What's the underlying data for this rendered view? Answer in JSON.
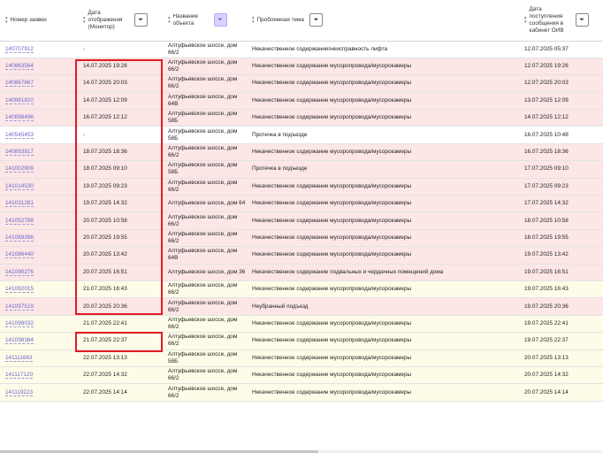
{
  "columns": {
    "number": "Номер заявки",
    "display_date": "Дата отображения (Монитор)",
    "object": "Название объекта",
    "topic": "Проблемная тема",
    "received": "Дата поступления сообщения в кабинет ОИВ"
  },
  "icons": {
    "sort": "sort-icon",
    "filter": "filter-icon"
  },
  "colors": {
    "pink_row": "#fde6e6",
    "cream_row": "#fefce8",
    "highlight": "#e01b24",
    "link": "#6a66c9"
  },
  "rows": [
    {
      "id": "140707912",
      "display": "-",
      "object": "Алтуфьевское шоссе, дом 66/2",
      "topic": "Некачественное содержание/неисправность лифта",
      "received": "12.07.2025 05:37",
      "tone": "white"
    },
    {
      "id": "140863564",
      "display": "14.07.2025 19:26",
      "object": "Алтуфьевское шоссе, дом 66/2",
      "topic": "Некачественное содержание мусоропровода/мусорокамеры",
      "received": "12.07.2025 19:26",
      "tone": "pink"
    },
    {
      "id": "140867867",
      "display": "14.07.2025 20:03",
      "object": "Алтуфьевское шоссе, дом 66/2",
      "topic": "Некачественное содержание мусоропровода/мусорокамеры",
      "received": "12.07.2025 20:03",
      "tone": "pink"
    },
    {
      "id": "140881810",
      "display": "14.07.2025 12:09",
      "object": "Алтуфьевское шоссе, дом 64В",
      "topic": "Некачественное содержание мусоропровода/мусорокамеры",
      "received": "13.07.2025 12:09",
      "tone": "pink"
    },
    {
      "id": "140898496",
      "display": "16.07.2025 12:12",
      "object": "Алтуфьевское шоссе, дом 58Б",
      "topic": "Некачественное содержание мусоропровода/мусорокамеры",
      "received": "14.07.2025 12:12",
      "tone": "pink"
    },
    {
      "id": "140545453",
      "display": "-",
      "object": "Алтуфьевское шоссе, дом 58Б",
      "topic": "Протечка в подъезде",
      "received": "16.07.2025 10:48",
      "tone": "white"
    },
    {
      "id": "140893817",
      "display": "18.07.2025 18:36",
      "object": "Алтуфьевское шоссе, дом 66/2",
      "topic": "Некачественное содержание мусоропровода/мусорокамеры",
      "received": "16.07.2025 18:36",
      "tone": "pink"
    },
    {
      "id": "141002909",
      "display": "18.07.2025 09:10",
      "object": "Алтуфьевское шоссе, дом 58Б",
      "topic": "Протечка в подъезде",
      "received": "17.07.2025 09:10",
      "tone": "pink"
    },
    {
      "id": "141014530",
      "display": "19.07.2025 09:23",
      "object": "Алтуфьевское шоссе, дом 66/2",
      "topic": "Некачественное содержание мусоропровода/мусорокамеры",
      "received": "17.07.2025 09:23",
      "tone": "pink"
    },
    {
      "id": "141031281",
      "display": "19.07.2025 14:32",
      "object": "Алтуфьевское шоссе, дом 64",
      "topic": "Некачественное содержание мусоропровода/мусорокамеры",
      "received": "17.07.2025 14:32",
      "tone": "pink"
    },
    {
      "id": "141052788",
      "display": "20.07.2025 10:58",
      "object": "Алтуфьевское шоссе, дом 66/2",
      "topic": "Некачественное содержание мусоропровода/мусорокамеры",
      "received": "18.07.2025 10:58",
      "tone": "pink"
    },
    {
      "id": "141069396",
      "display": "20.07.2025 19:55",
      "object": "Алтуфьевское шоссе, дом 66/2",
      "topic": "Некачественное содержание мусоропровода/мусорокамеры",
      "received": "18.07.2025 19:55",
      "tone": "pink"
    },
    {
      "id": "141086440",
      "display": "20.07.2025 13:42",
      "object": "Алтуфьевское шоссе, дом 64В",
      "topic": "Некачественное содержание мусоропровода/мусорокамеры",
      "received": "19.07.2025 13:42",
      "tone": "pink"
    },
    {
      "id": "141090276",
      "display": "20.07.2025 16:51",
      "object": "Алтуфьевское шоссе, дом 36",
      "topic": "Некачественное содержание подвальных и чердачных помещений дома",
      "received": "19.07.2025 16:51",
      "tone": "pink"
    },
    {
      "id": "141092015",
      "display": "21.07.2025 16:43",
      "object": "Алтуфьевское шоссе, дом 66/2",
      "topic": "Некачественное содержание мусоропровода/мусорокамеры",
      "received": "19.07.2025 16:43",
      "tone": "cream"
    },
    {
      "id": "141097519",
      "display": "20.07.2025 20:36",
      "object": "Алтуфьевское шоссе, дом 66/2",
      "topic": "Неубранный подъезд",
      "received": "19.07.2025 20:36",
      "tone": "pink"
    },
    {
      "id": "141098032",
      "display": "21.07.2025 22:41",
      "object": "Алтуфьевское шоссе, дом 66/2",
      "topic": "Некачественное содержание мусоропровода/мусорокамеры",
      "received": "19.07.2025 22:41",
      "tone": "cream"
    },
    {
      "id": "141098384",
      "display": "21.07.2025 22:37",
      "object": "Алтуфьевское шоссе, дом 66/2",
      "topic": "Некачественное содержание мусоропровода/мусорокамеры",
      "received": "19.07.2025 22:37",
      "tone": "cream"
    },
    {
      "id": "141111663",
      "display": "22.07.2025 13:13",
      "object": "Алтуфьевское шоссе, дом 58Б",
      "topic": "Некачественное содержание мусоропровода/мусорокамеры",
      "received": "20.07.2025 13:13",
      "tone": "cream"
    },
    {
      "id": "141117120",
      "display": "22.07.2025 14:32",
      "object": "Алтуфьевское шоссе, дом 66/2",
      "topic": "Некачественное содержание мусоропровода/мусорокамеры",
      "received": "20.07.2025 14:32",
      "tone": "cream"
    },
    {
      "id": "141119223",
      "display": "22.07.2025 14:14",
      "object": "Алтуфьевское шоссе, дом 66/2",
      "topic": "Некачественное содержание мусоропровода/мусорокамеры",
      "received": "20.07.2025 14:14",
      "tone": "cream"
    }
  ]
}
